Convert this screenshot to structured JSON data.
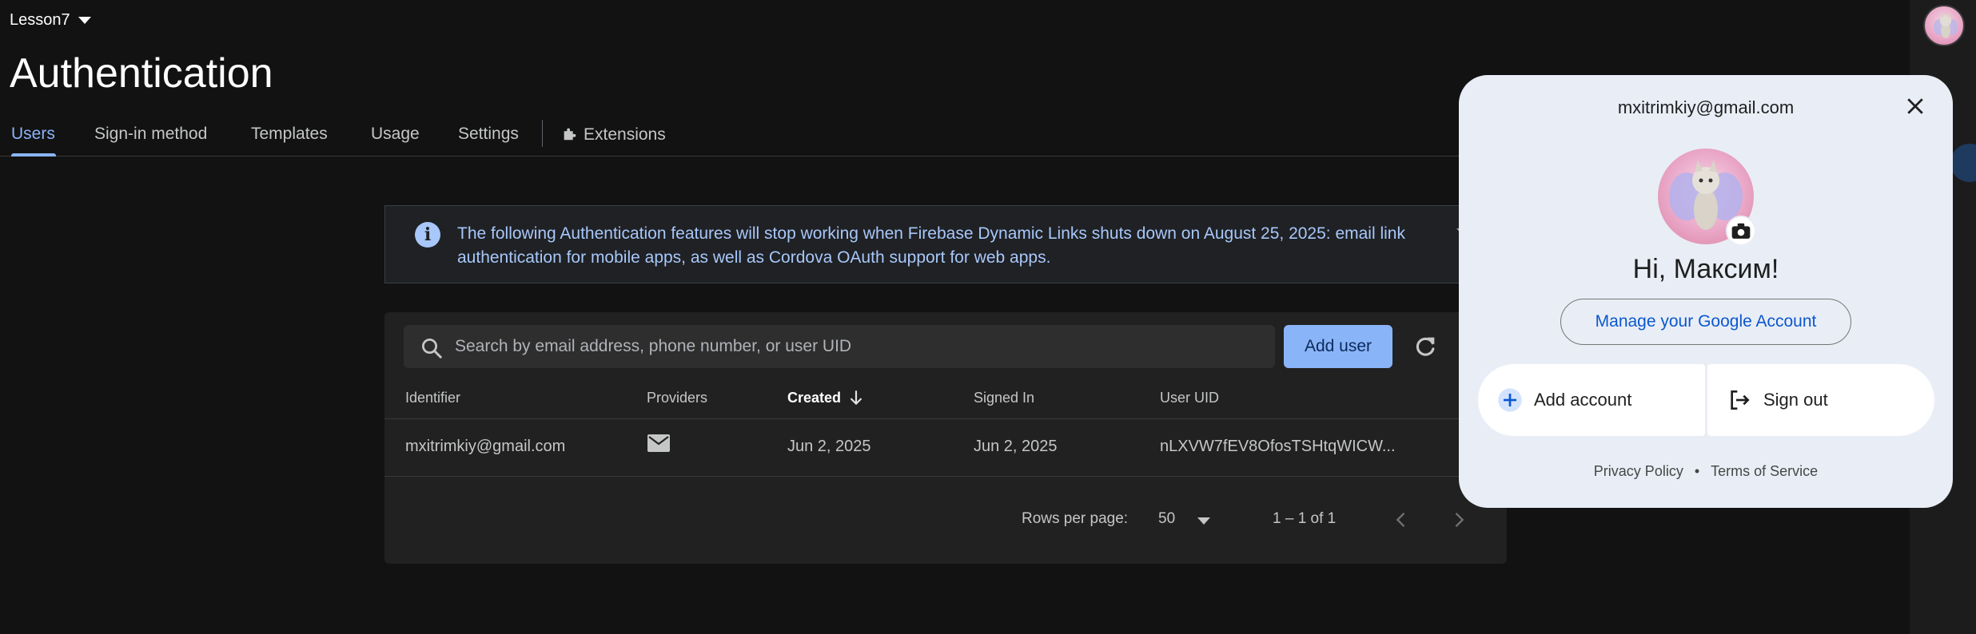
{
  "project": {
    "name": "Lesson7"
  },
  "page": {
    "title": "Authentication"
  },
  "tabs": [
    {
      "label": "Users",
      "active": true
    },
    {
      "label": "Sign-in method"
    },
    {
      "label": "Templates"
    },
    {
      "label": "Usage"
    },
    {
      "label": "Settings"
    },
    {
      "label": "Extensions"
    }
  ],
  "banner": {
    "text": "The following Authentication features will stop working when Firebase Dynamic Links shuts down on August 25, 2025: email link authentication for mobile apps, as well as Cordova OAuth support for web apps."
  },
  "users": {
    "search_placeholder": "Search by email address, phone number, or user UID",
    "add_user_label": "Add user",
    "columns": [
      "Identifier",
      "Providers",
      "Created",
      "Signed In",
      "User UID"
    ],
    "rows": [
      {
        "identifier": "mxitrimkiy@gmail.com",
        "provider_icon": "mail-icon",
        "created": "Jun 2, 2025",
        "signed_in": "Jun 2, 2025",
        "uid": "nLXVW7fEV8OfosTSHtqWICW..."
      }
    ],
    "rows_per_page_label": "Rows per page:",
    "rows_per_page_value": "50",
    "range": "1 – 1 of 1"
  },
  "account_popup": {
    "email": "mxitrimkiy@gmail.com",
    "greeting": "Hi, Максим!",
    "manage_label": "Manage your Google Account",
    "add_account_label": "Add account",
    "sign_out_label": "Sign out",
    "privacy_label": "Privacy Policy",
    "separator": "•",
    "terms_label": "Terms of Service"
  },
  "colors": {
    "accent": "#8ab4f8",
    "background": "#121212",
    "popup_bg": "#e9eef6",
    "link_blue": "#0b57d0"
  }
}
